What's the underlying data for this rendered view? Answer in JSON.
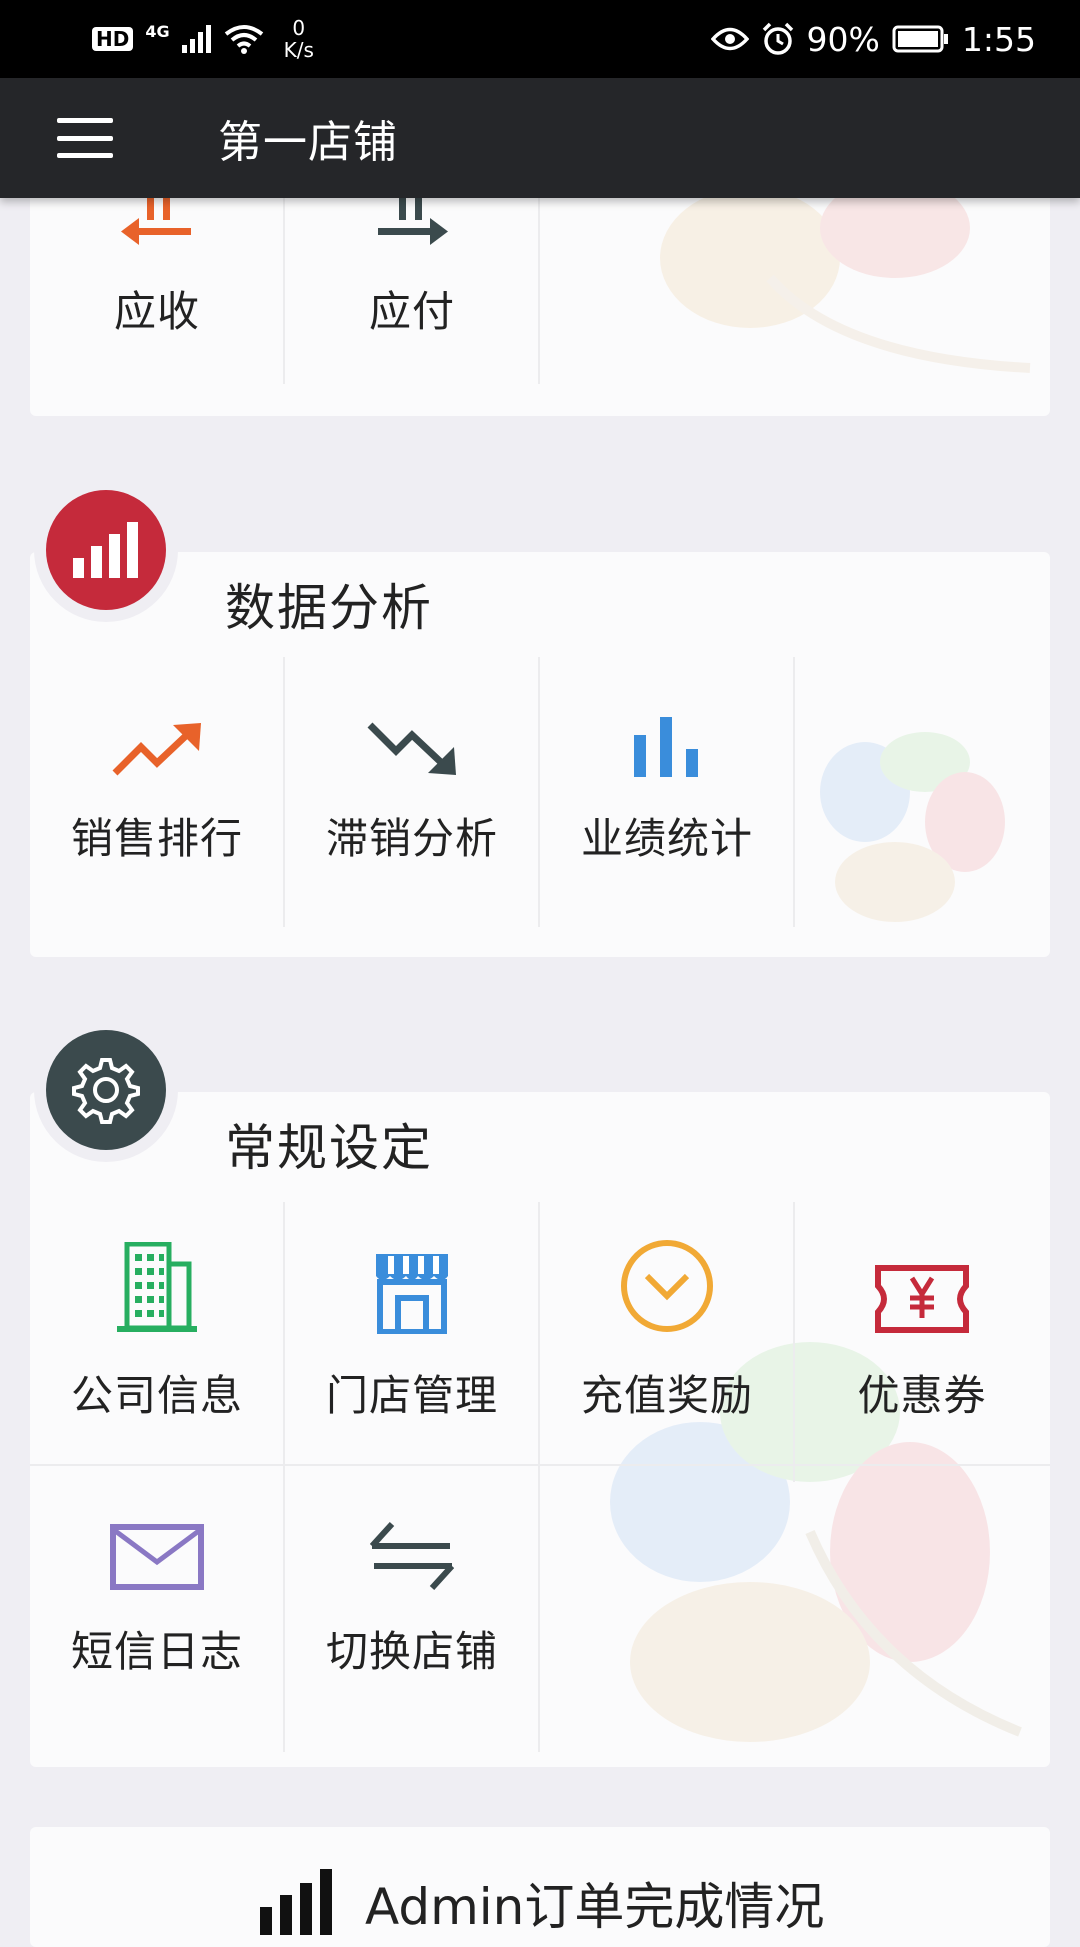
{
  "status_bar": {
    "hd": "HD",
    "network": "4G",
    "speed_value": "0",
    "speed_unit": "K/s",
    "battery": "90%",
    "time": "1:55"
  },
  "app_bar": {
    "title": "第一店铺"
  },
  "top_section": {
    "items": [
      {
        "label": "应收",
        "icon": "arrow-left-receivable-icon",
        "color": "#e8622a"
      },
      {
        "label": "应付",
        "icon": "arrow-right-payable-icon",
        "color": "#3b4a4d"
      }
    ]
  },
  "analysis_section": {
    "title": "数据分析",
    "badge_icon": "bar-chart-icon",
    "badge_color": "#c52a3b",
    "items": [
      {
        "label": "销售排行",
        "icon": "trend-up-icon",
        "color": "#e8622a"
      },
      {
        "label": "滞销分析",
        "icon": "trend-down-icon",
        "color": "#3b4a4d"
      },
      {
        "label": "业绩统计",
        "icon": "bar-stats-icon",
        "color": "#3a8ddb"
      }
    ]
  },
  "settings_section": {
    "title": "常规设定",
    "badge_icon": "gear-icon",
    "badge_color": "#3b4a4d",
    "items": [
      {
        "label": "公司信息",
        "icon": "building-icon",
        "color": "#27ae60"
      },
      {
        "label": "门店管理",
        "icon": "store-icon",
        "color": "#3a8ddb"
      },
      {
        "label": "充值奖励",
        "icon": "circle-chevron-icon",
        "color": "#f1a935"
      },
      {
        "label": "优惠券",
        "icon": "coupon-icon",
        "color": "#c52a3b"
      },
      {
        "label": "短信日志",
        "icon": "envelope-icon",
        "color": "#8a78c4"
      },
      {
        "label": "切换店铺",
        "icon": "switch-arrows-icon",
        "color": "#3b4a4d"
      }
    ]
  },
  "bottom_section": {
    "title": "Admin订单完成情况",
    "icon": "bar-chart-icon"
  }
}
